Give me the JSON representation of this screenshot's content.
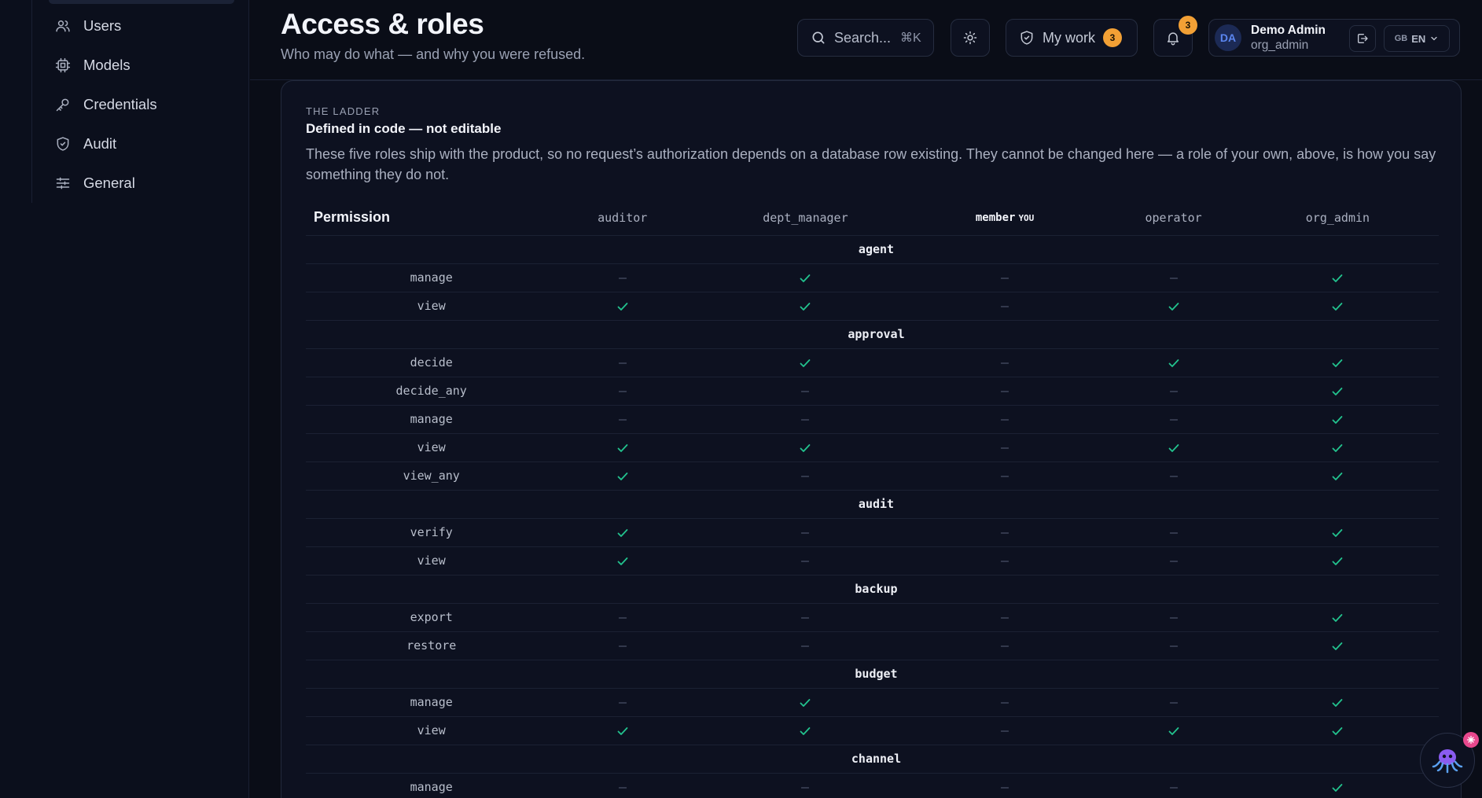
{
  "sidebar": {
    "items": [
      {
        "label": "Users",
        "icon": "users-icon"
      },
      {
        "label": "Models",
        "icon": "chip-icon"
      },
      {
        "label": "Credentials",
        "icon": "key-icon"
      },
      {
        "label": "Audit",
        "icon": "shield-icon"
      },
      {
        "label": "General",
        "icon": "sliders-icon"
      }
    ]
  },
  "header": {
    "title": "Access & roles",
    "subtitle": "Who may do what — and why you were refused.",
    "search_label": "Search...",
    "search_shortcut": "⌘K",
    "my_work_label": "My work",
    "my_work_count": "3",
    "notifications_count": "3",
    "user": {
      "initials": "DA",
      "name": "Demo Admin",
      "role": "org_admin"
    },
    "language": {
      "flag": "GB",
      "code": "EN"
    }
  },
  "ladder": {
    "eyebrow": "THE LADDER",
    "title": "Defined in code — not editable",
    "description": "These five roles ship with the product, so no request’s authorization depends on a database row existing. They cannot be changed here — a role of your own, above, is how you say something they do not.",
    "permission_header": "Permission",
    "you_tag": "YOU",
    "roles": [
      "auditor",
      "dept_manager",
      "member",
      "operator",
      "org_admin"
    ],
    "current_role": "member",
    "groups": [
      {
        "name": "agent",
        "actions": [
          {
            "name": "manage",
            "grants": [
              false,
              true,
              false,
              false,
              true
            ]
          },
          {
            "name": "view",
            "grants": [
              true,
              true,
              false,
              true,
              true
            ]
          }
        ]
      },
      {
        "name": "approval",
        "actions": [
          {
            "name": "decide",
            "grants": [
              false,
              true,
              false,
              true,
              true
            ]
          },
          {
            "name": "decide_any",
            "grants": [
              false,
              false,
              false,
              false,
              true
            ]
          },
          {
            "name": "manage",
            "grants": [
              false,
              false,
              false,
              false,
              true
            ]
          },
          {
            "name": "view",
            "grants": [
              true,
              true,
              false,
              true,
              true
            ]
          },
          {
            "name": "view_any",
            "grants": [
              true,
              false,
              false,
              false,
              true
            ]
          }
        ]
      },
      {
        "name": "audit",
        "actions": [
          {
            "name": "verify",
            "grants": [
              true,
              false,
              false,
              false,
              true
            ]
          },
          {
            "name": "view",
            "grants": [
              true,
              false,
              false,
              false,
              true
            ]
          }
        ]
      },
      {
        "name": "backup",
        "actions": [
          {
            "name": "export",
            "grants": [
              false,
              false,
              false,
              false,
              true
            ]
          },
          {
            "name": "restore",
            "grants": [
              false,
              false,
              false,
              false,
              true
            ]
          }
        ]
      },
      {
        "name": "budget",
        "actions": [
          {
            "name": "manage",
            "grants": [
              false,
              true,
              false,
              false,
              true
            ]
          },
          {
            "name": "view",
            "grants": [
              true,
              true,
              false,
              true,
              true
            ]
          }
        ]
      },
      {
        "name": "channel",
        "actions": [
          {
            "name": "manage",
            "grants": [
              false,
              false,
              false,
              false,
              true
            ]
          }
        ]
      }
    ]
  },
  "colors": {
    "check": "#22c38e",
    "dash": "#4a5166",
    "accent_badge": "#f2a035"
  }
}
